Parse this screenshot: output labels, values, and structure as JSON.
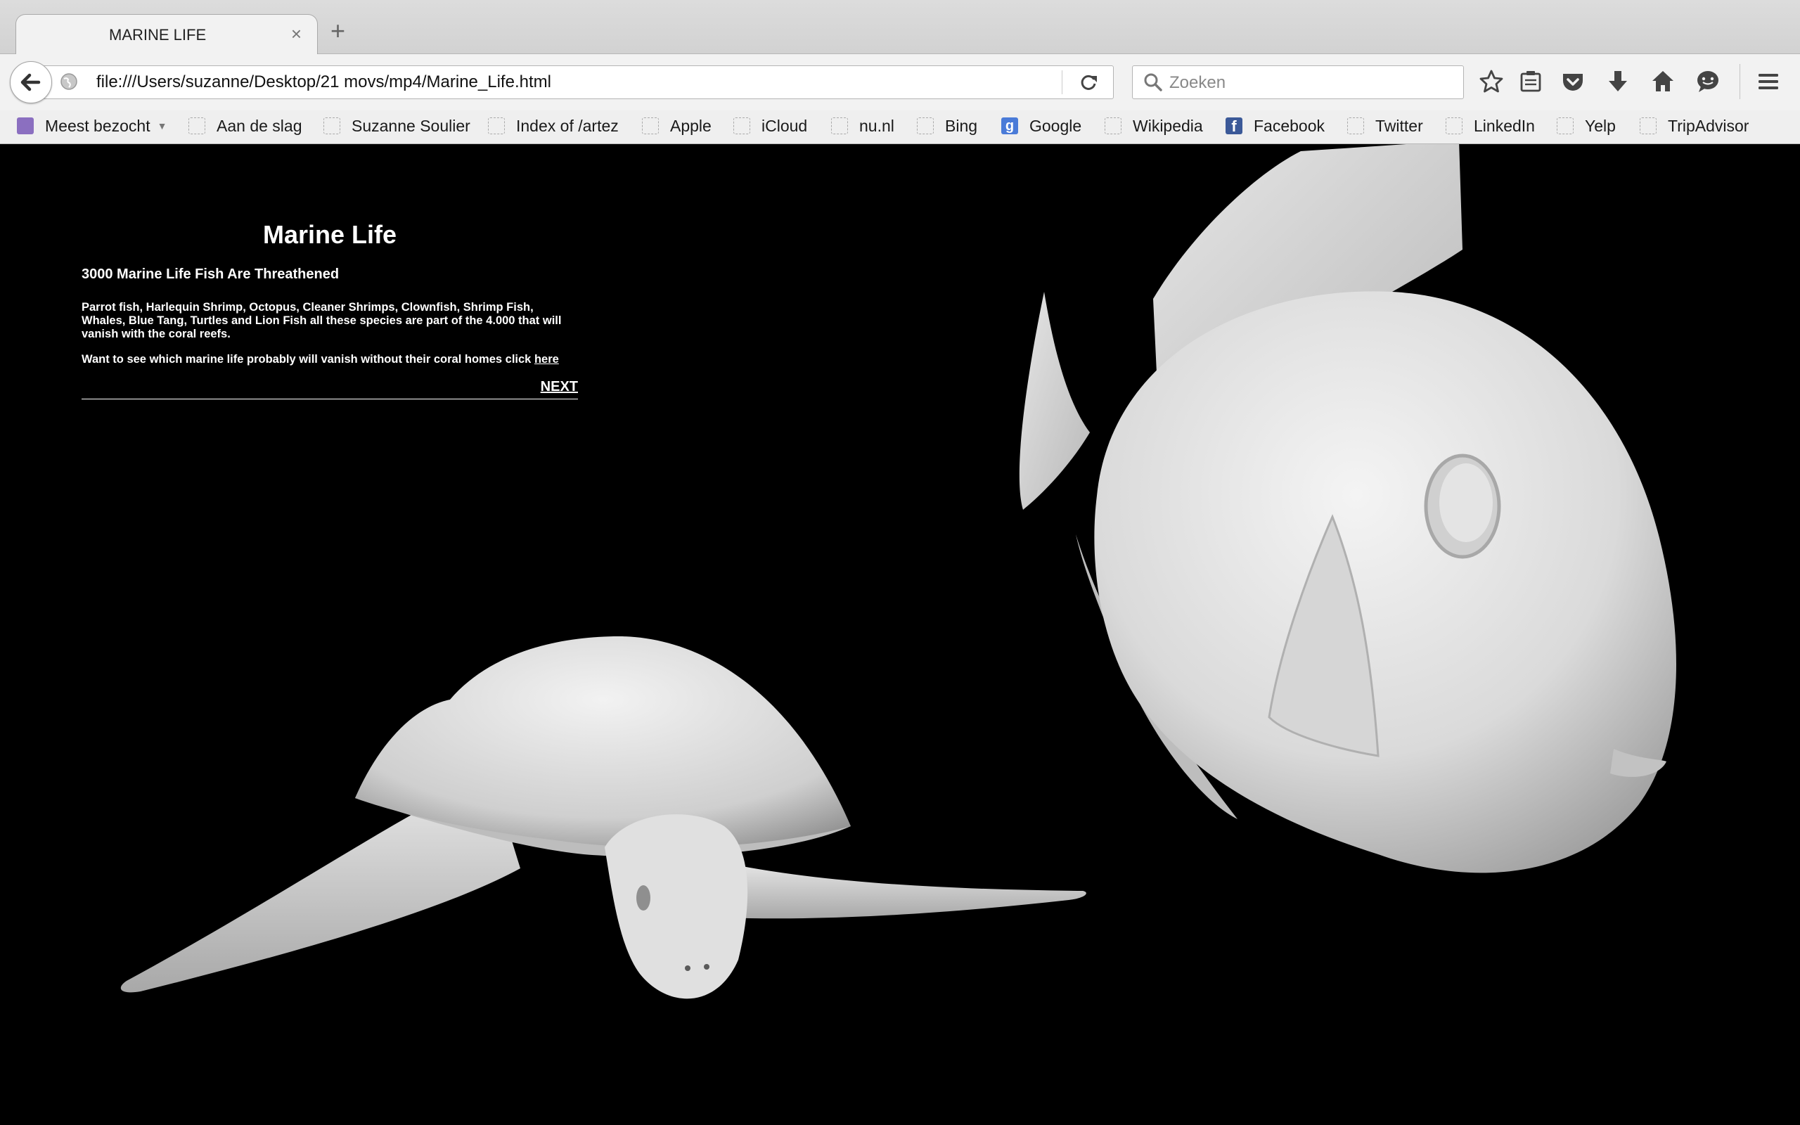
{
  "browser": {
    "tab_title": "MARINE LIFE",
    "tab_close": "×",
    "new_tab": "+",
    "url": "file:///Users/suzanne/Desktop/21 movs/mp4/Marine_Life.html",
    "search_placeholder": "Zoeken",
    "toolbar_icons": [
      "star-icon",
      "reading-list-icon",
      "pocket-icon",
      "download-icon",
      "home-icon",
      "chat-icon",
      "menu-icon"
    ]
  },
  "bookmarks": [
    {
      "label": "Meest bezocht",
      "icon": "folder-icon"
    },
    {
      "label": "Aan de slag",
      "icon": "page-icon"
    },
    {
      "label": "Suzanne Soulier",
      "icon": "page-icon"
    },
    {
      "label": "Index of /artez",
      "icon": "page-icon"
    },
    {
      "label": "Apple",
      "icon": "page-icon"
    },
    {
      "label": "iCloud",
      "icon": "page-icon"
    },
    {
      "label": "nu.nl",
      "icon": "page-icon"
    },
    {
      "label": "Bing",
      "icon": "page-icon"
    },
    {
      "label": "Google",
      "icon": "google-icon"
    },
    {
      "label": "Wikipedia",
      "icon": "page-icon"
    },
    {
      "label": "Facebook",
      "icon": "facebook-icon"
    },
    {
      "label": "Twitter",
      "icon": "page-icon"
    },
    {
      "label": "LinkedIn",
      "icon": "page-icon"
    },
    {
      "label": "Yelp",
      "icon": "page-icon"
    },
    {
      "label": "TripAdvisor",
      "icon": "page-icon"
    }
  ],
  "page": {
    "title": "Marine Life",
    "subtitle": "3000 Marine Life Fish Are Threathened",
    "paragraph1": "Parrot fish, Harlequin Shrimp, Octopus, Cleaner Shrimps, Clownfish, Shrimp Fish, Whales, Blue Tang, Turtles and Lion Fish all these species are part of the 4.000 that will vanish with the coral reefs.",
    "paragraph2": "Want to see which marine life probably will vanish without their coral homes click",
    "here_link": "here",
    "next_link": "NEXT"
  }
}
